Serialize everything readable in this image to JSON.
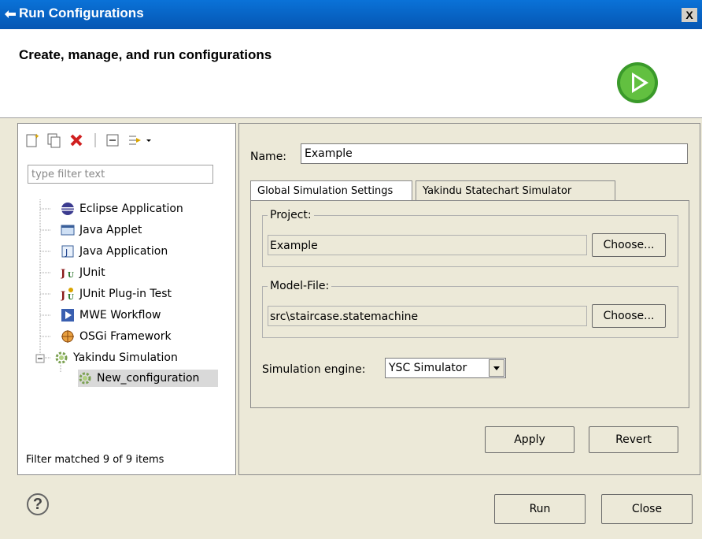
{
  "window": {
    "title": "Run Configurations",
    "close_label": "X"
  },
  "header": {
    "title": "Create, manage, and run configurations"
  },
  "sidebar": {
    "filter_placeholder": "type filter text",
    "items": [
      {
        "label": "Eclipse Application",
        "icon": "eclipse-icon"
      },
      {
        "label": "Java Applet",
        "icon": "java-applet-icon"
      },
      {
        "label": "Java Application",
        "icon": "java-application-icon"
      },
      {
        "label": "JUnit",
        "icon": "junit-icon"
      },
      {
        "label": "JUnit Plug-in Test",
        "icon": "junit-plugin-icon"
      },
      {
        "label": "MWE Workflow",
        "icon": "mwe-workflow-icon"
      },
      {
        "label": "OSGi Framework",
        "icon": "osgi-icon"
      },
      {
        "label": "Yakindu Simulation",
        "icon": "yakindu-icon",
        "expanded": true
      },
      {
        "label": "New_configuration",
        "icon": "yakindu-config-icon",
        "selected": true
      }
    ],
    "status": "Filter matched 9 of 9 items"
  },
  "config": {
    "name_label": "Name:",
    "name_value": "Example",
    "tabs": [
      {
        "label": "Global Simulation Settings",
        "active": true
      },
      {
        "label": "Yakindu Statechart Simulator",
        "active": false
      }
    ],
    "project": {
      "label": "Project:",
      "value": "Example",
      "choose_label": "Choose..."
    },
    "model_file": {
      "label": "Model-File:",
      "value": "src\\staircase.statemachine",
      "choose_label": "Choose..."
    },
    "engine": {
      "label": "Simulation engine:",
      "value": "YSC Simulator"
    },
    "apply_label": "Apply",
    "revert_label": "Revert"
  },
  "footer": {
    "help_label": "?",
    "run_label": "Run",
    "close_label": "Close"
  }
}
